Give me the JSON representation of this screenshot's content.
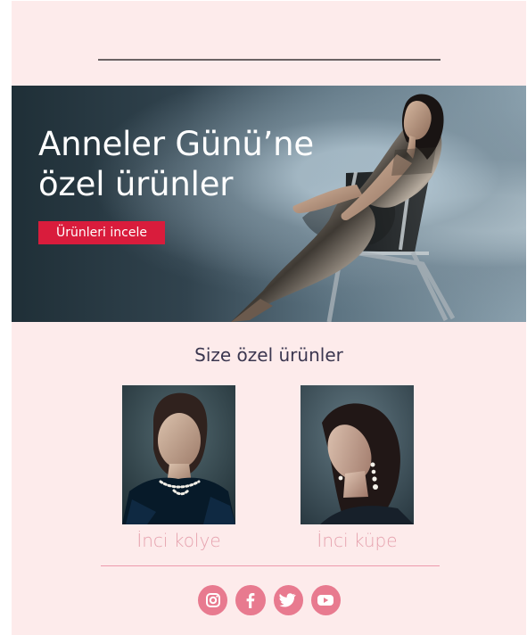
{
  "brand": {
    "background": "#fdebeb",
    "accent": "#d91c3c",
    "social_color": "#e87a8f",
    "product_text_color": "#e6a2ae"
  },
  "hero": {
    "headline": "Anneler Günü’ne özel ürünler",
    "cta_label": "Ürünleri incele"
  },
  "section": {
    "title": "Size özel ürünler"
  },
  "products": [
    {
      "name": "İnci kolye"
    },
    {
      "name": "İnci küpe"
    }
  ],
  "social": [
    {
      "icon": "instagram-icon"
    },
    {
      "icon": "facebook-icon"
    },
    {
      "icon": "twitter-icon"
    },
    {
      "icon": "youtube-icon"
    }
  ]
}
